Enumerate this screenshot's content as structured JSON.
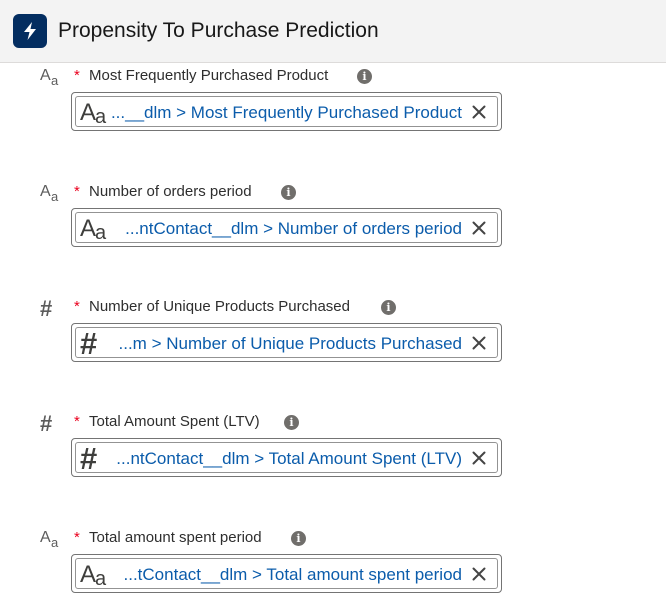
{
  "header": {
    "title": "Propensity To Purchase Prediction",
    "icon": "lightning-bolt-icon",
    "icon_bg": "#032d60"
  },
  "fields": [
    {
      "label": "Most Frequently Purchased Product",
      "required": "*",
      "type_icon": "text-type-icon",
      "value": "...__dlm > Most Frequently Purchased Product"
    },
    {
      "label": "Number of orders period",
      "required": "*",
      "type_icon": "text-type-icon",
      "value": "...ntContact__dlm > Number of orders period"
    },
    {
      "label": "Number of Unique Products Purchased",
      "required": "*",
      "type_icon": "number-type-icon",
      "value": "...m > Number of Unique Products Purchased"
    },
    {
      "label": "Total Amount Spent (LTV)",
      "required": "*",
      "type_icon": "number-type-icon",
      "value": "...ntContact__dlm > Total Amount Spent (LTV)"
    },
    {
      "label": "Total amount spent period",
      "required": "*",
      "type_icon": "text-type-icon",
      "value": "...tContact__dlm > Total amount spent period"
    }
  ],
  "colors": {
    "link": "#0b5cab",
    "required": "#ea001e",
    "info": "#706e6b"
  }
}
